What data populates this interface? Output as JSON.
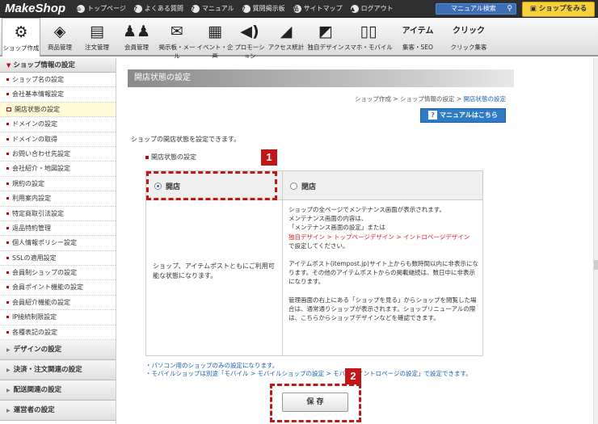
{
  "topbar": {
    "logo": "MakeShop",
    "links": [
      {
        "label": "トップページ",
        "icon": "home-icon",
        "glyph": "⌂"
      },
      {
        "label": "よくある質問",
        "icon": "question-icon",
        "glyph": "?"
      },
      {
        "label": "マニュアル",
        "icon": "question-icon",
        "glyph": "?"
      },
      {
        "label": "質問掲示板",
        "icon": "question-icon",
        "glyph": "?"
      },
      {
        "label": "サイトマップ",
        "icon": "sitemap-icon",
        "glyph": "品"
      },
      {
        "label": "ログアウト",
        "icon": "logout-icon",
        "glyph": "▲"
      }
    ],
    "search_label": "マニュアル検索",
    "view_shop": "ショップをみる"
  },
  "nav": [
    {
      "label": "ショップ作成",
      "glyph": "⚙"
    },
    {
      "label": "商品管理",
      "glyph": "◈"
    },
    {
      "label": "注文管理",
      "glyph": "▤"
    },
    {
      "label": "会員管理",
      "glyph": "♟♟"
    },
    {
      "label": "掲示板・メール",
      "glyph": "✉"
    },
    {
      "label": "イベント・企画",
      "glyph": "▦"
    },
    {
      "label": "プロモーション",
      "glyph": "◀)"
    },
    {
      "label": "アクセス統計",
      "glyph": "◢"
    },
    {
      "label": "独自デザイン",
      "glyph": "◩"
    },
    {
      "label": "スマホ・モバイル",
      "glyph": "▯▯"
    },
    {
      "label": "集客・SEO",
      "glyph": "アイテム"
    },
    {
      "label": "クリック集客",
      "glyph": "クリック"
    }
  ],
  "sidebar": {
    "heading": "ショップ情報の設定",
    "items": [
      "ショップ名の設定",
      "会社基本情報設定",
      "開店状態の設定",
      "ドメインの設定",
      "ドメインの取得",
      "お問い合わせ先設定",
      "会社紹介・地図設定",
      "規約の設定",
      "利用案内設定",
      "特定商取引法設定",
      "返品特約管理",
      "個人情報ポリシー設定",
      "SSLの適用設定",
      "会員制ショップの設定",
      "会員ポイント機能の設定",
      "会員紹介機能の設定",
      "IP接続制限設定",
      "各種表記の設定"
    ],
    "active_index": 2,
    "groups": [
      "デザインの設定",
      "決済・注文関連の設定",
      "配送関連の設定",
      "運営者の設定"
    ]
  },
  "main": {
    "title": "開店状態の設定",
    "breadcrumb": {
      "a": "ショップ作成",
      "b": "ショップ情報の設定",
      "current": "開店状態の設定"
    },
    "manual_button": "マニュアルはこちら",
    "description": "ショップの開店状態を設定できます。",
    "section_label": "開店状態の設定",
    "option_open": "開店",
    "option_closed": "閉店",
    "open_desc": "ショップ、アイテムポストともにご利用可能な状態になります。",
    "closed_p1a": "ショップの全ページでメンテナンス画面が表示されます。",
    "closed_p1b": "メンテナンス画面の内容は、",
    "closed_p1c": "「メンテナンス画面の設定」または",
    "closed_p1_link": "独自デザイン > トップページデザイン > イントロページデザイン",
    "closed_p1d": "で設定してください。",
    "closed_p2": "アイテムポスト(itempost.jp)サイト上からも数時間以内に非表示になります。その他のアイテムポストからの掲載継続は、数日中に非表示になります。",
    "closed_p3": "管理画面の右上にある「ショップを見る」からショップを閲覧した場合は、通常通りショップが表示されます。ショップリニューアルの際は、こちらからショップデザインなどを確認できます。",
    "note1": "・パソコン用のショップのみの設定になります。",
    "note2": "・モバイルショップは別途「モバイル > モバイルショップの設定 > モバイルイントロページの設定」で設定できます。",
    "save_label": "保 存",
    "badge1": "1",
    "badge2": "2"
  }
}
